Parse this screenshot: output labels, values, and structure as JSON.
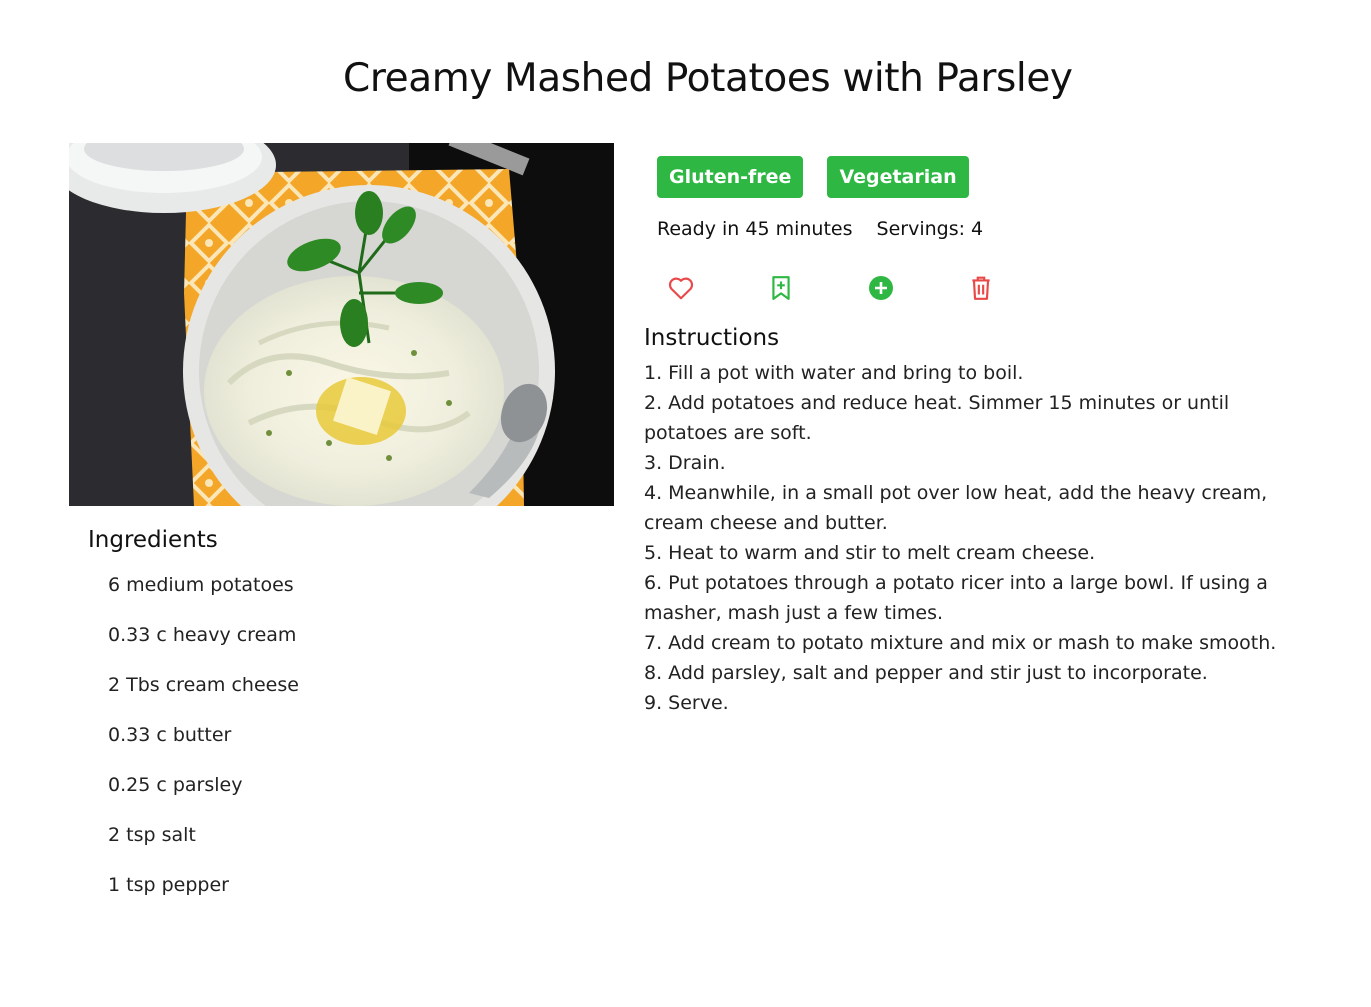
{
  "recipe": {
    "title": "Creamy Mashed Potatoes with Parsley",
    "tags": [
      "Gluten-free",
      "Vegetarian"
    ],
    "ready_time": "Ready in 45 minutes",
    "servings": "Servings: 4",
    "actions": [
      {
        "name": "favorite",
        "icon": "heart-icon",
        "color": "#e84a4a"
      },
      {
        "name": "bookmark",
        "icon": "bookmark-plus-icon",
        "color": "#2eb843"
      },
      {
        "name": "add",
        "icon": "plus-circle-icon",
        "color": "#2eb843"
      },
      {
        "name": "delete",
        "icon": "trash-icon",
        "color": "#e84a4a"
      }
    ],
    "ingredients_title": "Ingredients",
    "ingredients": [
      "6 medium potatoes",
      "0.33 c heavy cream",
      "2 Tbs cream cheese",
      "0.33 c butter",
      "0.25 c parsley",
      "2 tsp salt",
      "1 tsp pepper"
    ],
    "instructions_title": "Instructions",
    "instructions": [
      "1. Fill a pot with water and bring to boil.",
      "2. Add potatoes and reduce heat. Simmer 15 minutes or until potatoes are soft.",
      "3. Drain.",
      "4. Meanwhile, in a small pot over low heat, add the heavy cream, cream cheese and butter.",
      "5. Heat to warm and stir to melt cream cheese.",
      "6. Put potatoes through a potato ricer into a large bowl. If using a masher, mash just a few times.",
      "7. Add cream to potato mixture and mix or mash to make smooth.",
      "8. Add parsley, salt and pepper and stir just to incorporate.",
      "9. Serve."
    ]
  },
  "colors": {
    "tag_bg": "#2eb843",
    "tag_text": "#ffffff",
    "danger": "#e84a4a",
    "success": "#2eb843"
  }
}
